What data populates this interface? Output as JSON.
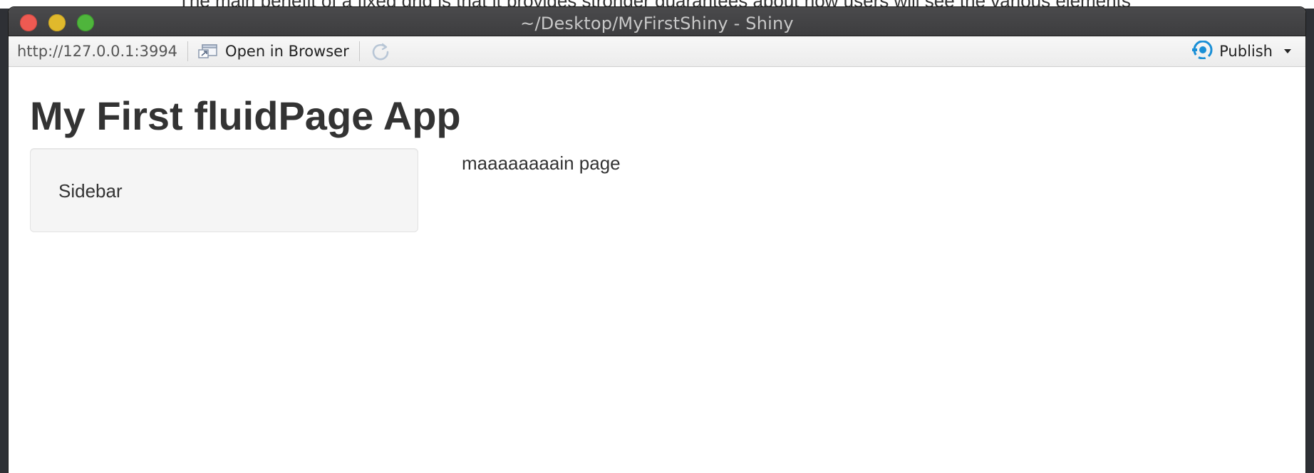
{
  "background": {
    "partial_text": "The main benefit of a fixed grid is that it provides stronger guarantees about how users will see the various elements"
  },
  "window": {
    "title": "~/Desktop/MyFirstShiny - Shiny"
  },
  "toolbar": {
    "url": "http://127.0.0.1:3994",
    "open_in_browser_label": "Open in Browser",
    "publish_label": "Publish"
  },
  "app": {
    "title": "My First fluidPage App",
    "sidebar_text": "Sidebar",
    "main_text": "maaaaaaaain page"
  },
  "icons": {
    "open_in_browser": "open-in-browser-icon",
    "refresh": "refresh-icon",
    "publish": "publish-icon",
    "dropdown": "chevron-down-icon"
  },
  "colors": {
    "publish_icon": "#1a8fd6",
    "close": "#ee5a52",
    "minimize": "#e0b92c",
    "zoom": "#4fb53c",
    "sidebar_bg": "#f5f5f5"
  }
}
